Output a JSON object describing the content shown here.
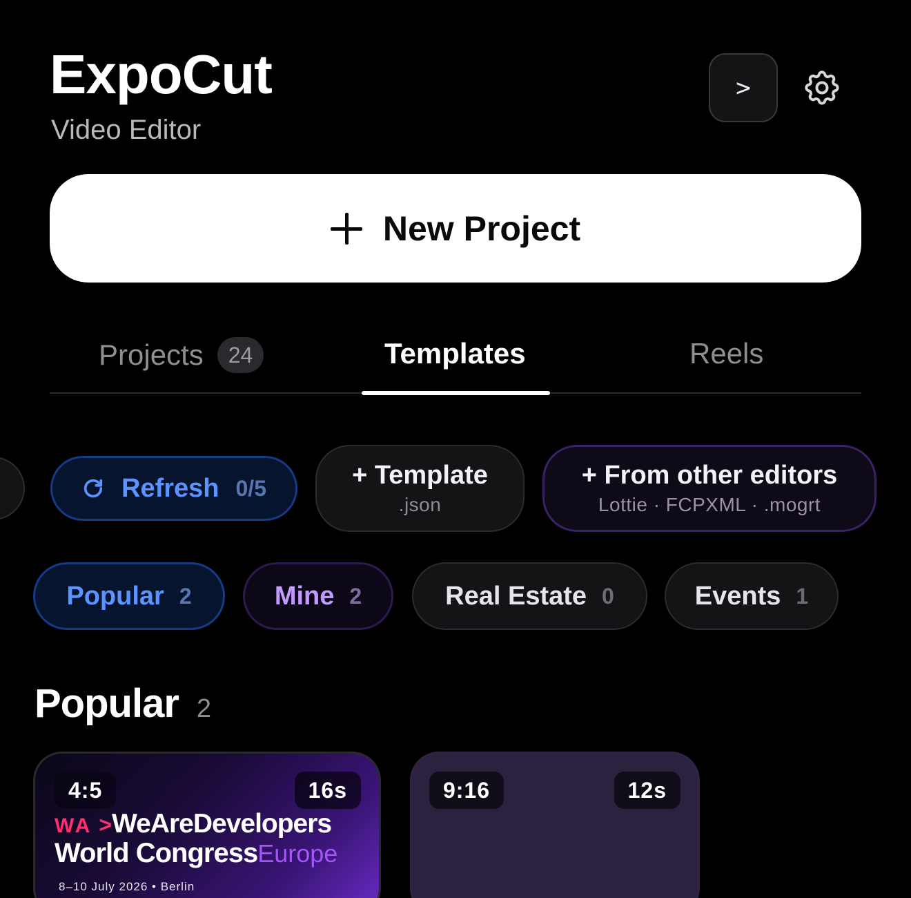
{
  "header": {
    "title": "ExpoCut",
    "subtitle": "Video Editor",
    "terminal_label": ">",
    "settings_icon": "gear-icon"
  },
  "new_project": {
    "label": "New Project",
    "icon": "plus-icon"
  },
  "tabs": [
    {
      "label": "Projects",
      "count": "24",
      "active": false
    },
    {
      "label": "Templates",
      "active": true
    },
    {
      "label": "Reels",
      "active": false
    }
  ],
  "actions": {
    "refresh": {
      "label": "Refresh",
      "count": "0/5",
      "icon": "refresh-icon"
    },
    "template_json": {
      "label": "+ Template",
      "sub": ".json"
    },
    "other_editors": {
      "label": "+ From other editors",
      "sub": "Lottie · FCPXML · .mogrt"
    }
  },
  "categories": [
    {
      "label": "Popular",
      "count": "2"
    },
    {
      "label": "Mine",
      "count": "2"
    },
    {
      "label": "Real Estate",
      "count": "0"
    },
    {
      "label": "Events",
      "count": "1"
    }
  ],
  "section": {
    "title": "Popular",
    "count": "2"
  },
  "cards": [
    {
      "ratio": "4:5",
      "duration": "16s",
      "poster": {
        "wa": "WA",
        "arrow": ">",
        "brand": "WeAreDevelopers",
        "line2": "World Congress",
        "line2_accent": "Europe",
        "date": "8–10 July 2026 • Berlin"
      }
    },
    {
      "ratio": "9:16",
      "duration": "12s"
    }
  ],
  "colors": {
    "background": "#000000",
    "accent_blue": "#5b93ff",
    "accent_purple": "#c39bff",
    "brand_pink": "#ff2f6e"
  }
}
